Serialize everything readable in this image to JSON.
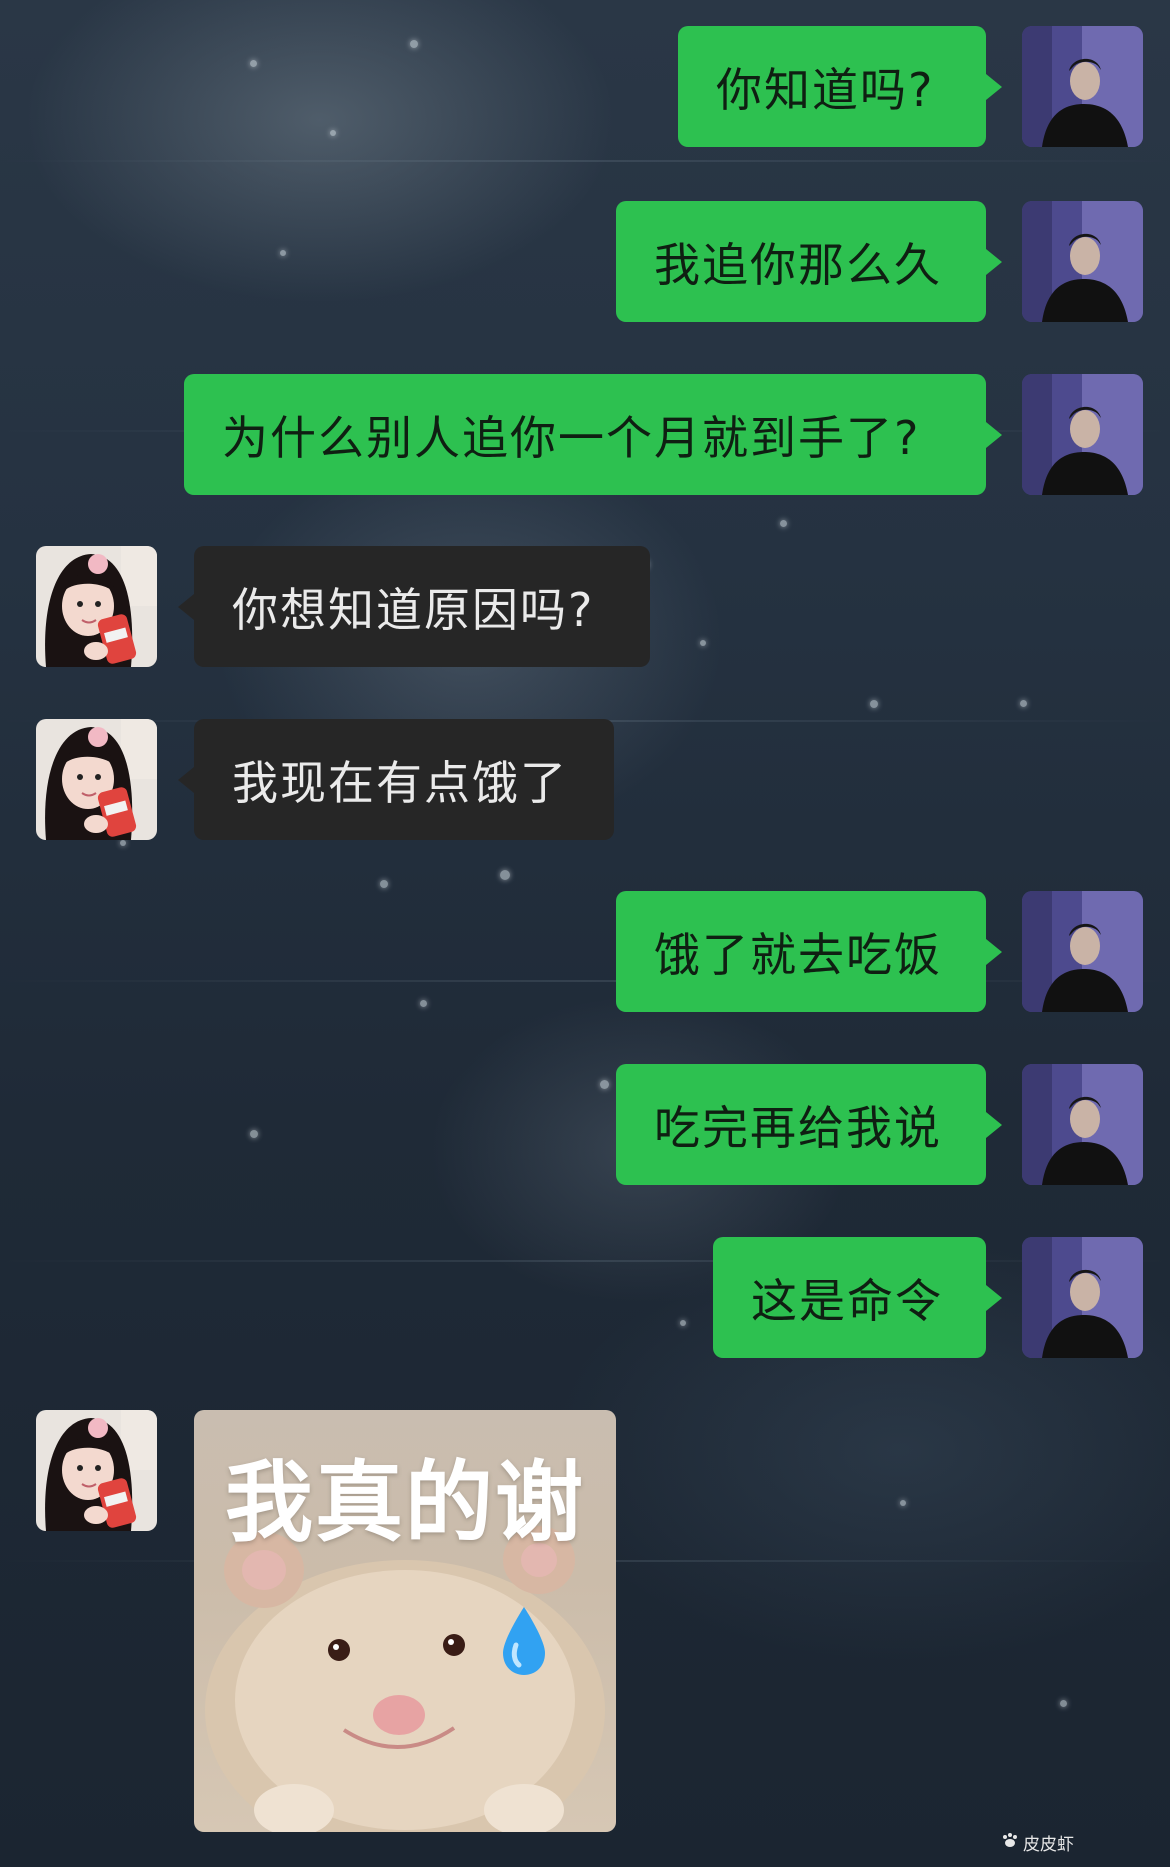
{
  "messages": [
    {
      "side": "me",
      "text": "你知道吗?"
    },
    {
      "side": "me",
      "text": "我追你那么久"
    },
    {
      "side": "me",
      "text": "为什么别人追你一个月就到手了?"
    },
    {
      "side": "her",
      "text": "你想知道原因吗?"
    },
    {
      "side": "her",
      "text": "我现在有点饿了"
    },
    {
      "side": "me",
      "text": "饿了就去吃饭"
    },
    {
      "side": "me",
      "text": "吃完再给我说"
    },
    {
      "side": "me",
      "text": "这是命令"
    }
  ],
  "sticker": {
    "caption": "我真的谢",
    "icon": "sweat-drop-icon"
  },
  "watermark": {
    "text": "皮皮虾",
    "icon": "paw-icon"
  },
  "colors": {
    "sent_bubble": "#2dc150",
    "received_bubble": "#262626"
  }
}
